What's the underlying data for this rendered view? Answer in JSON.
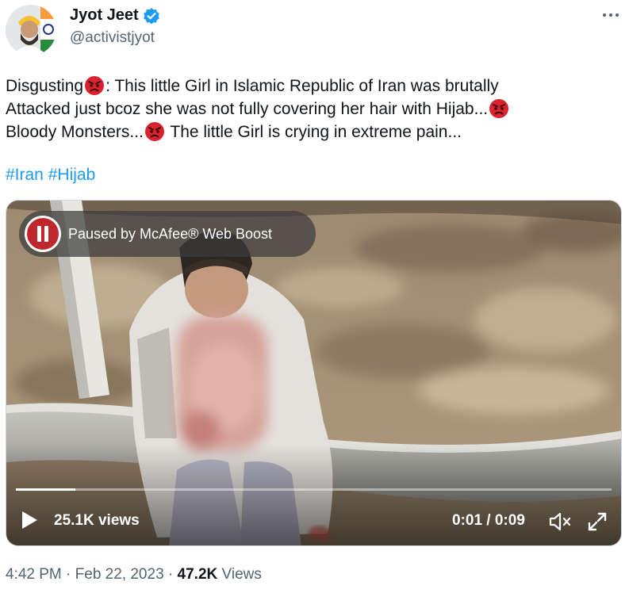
{
  "author": {
    "name": "Jyot Jeet",
    "handle": "@activistjyot",
    "verified_color": "#1d9bf0"
  },
  "tweet": {
    "lines": [
      {
        "before": "Disgusting",
        "after": ":  This little Girl in Islamic Republic of Iran was brutally"
      },
      {
        "before": "Attacked just bcoz she was not fully covering her hair with Hijab...",
        "after": ""
      },
      {
        "before": "Bloody Monsters...",
        "after": " The little Girl is crying in extreme pain..."
      }
    ],
    "emoji": "angry-face",
    "hashtags": [
      "#Iran",
      "#Hijab"
    ]
  },
  "video": {
    "overlay_label": "Paused by McAfee® Web Boost",
    "views": "25.1K views",
    "time": "0:01 / 0:09",
    "progress": 0.1,
    "overlay_color": "#c0272d"
  },
  "meta": {
    "time": "4:42 PM",
    "date": "Feb 22, 2023",
    "views_count": "47.2K",
    "views_label": " Views",
    "separator": " · "
  }
}
